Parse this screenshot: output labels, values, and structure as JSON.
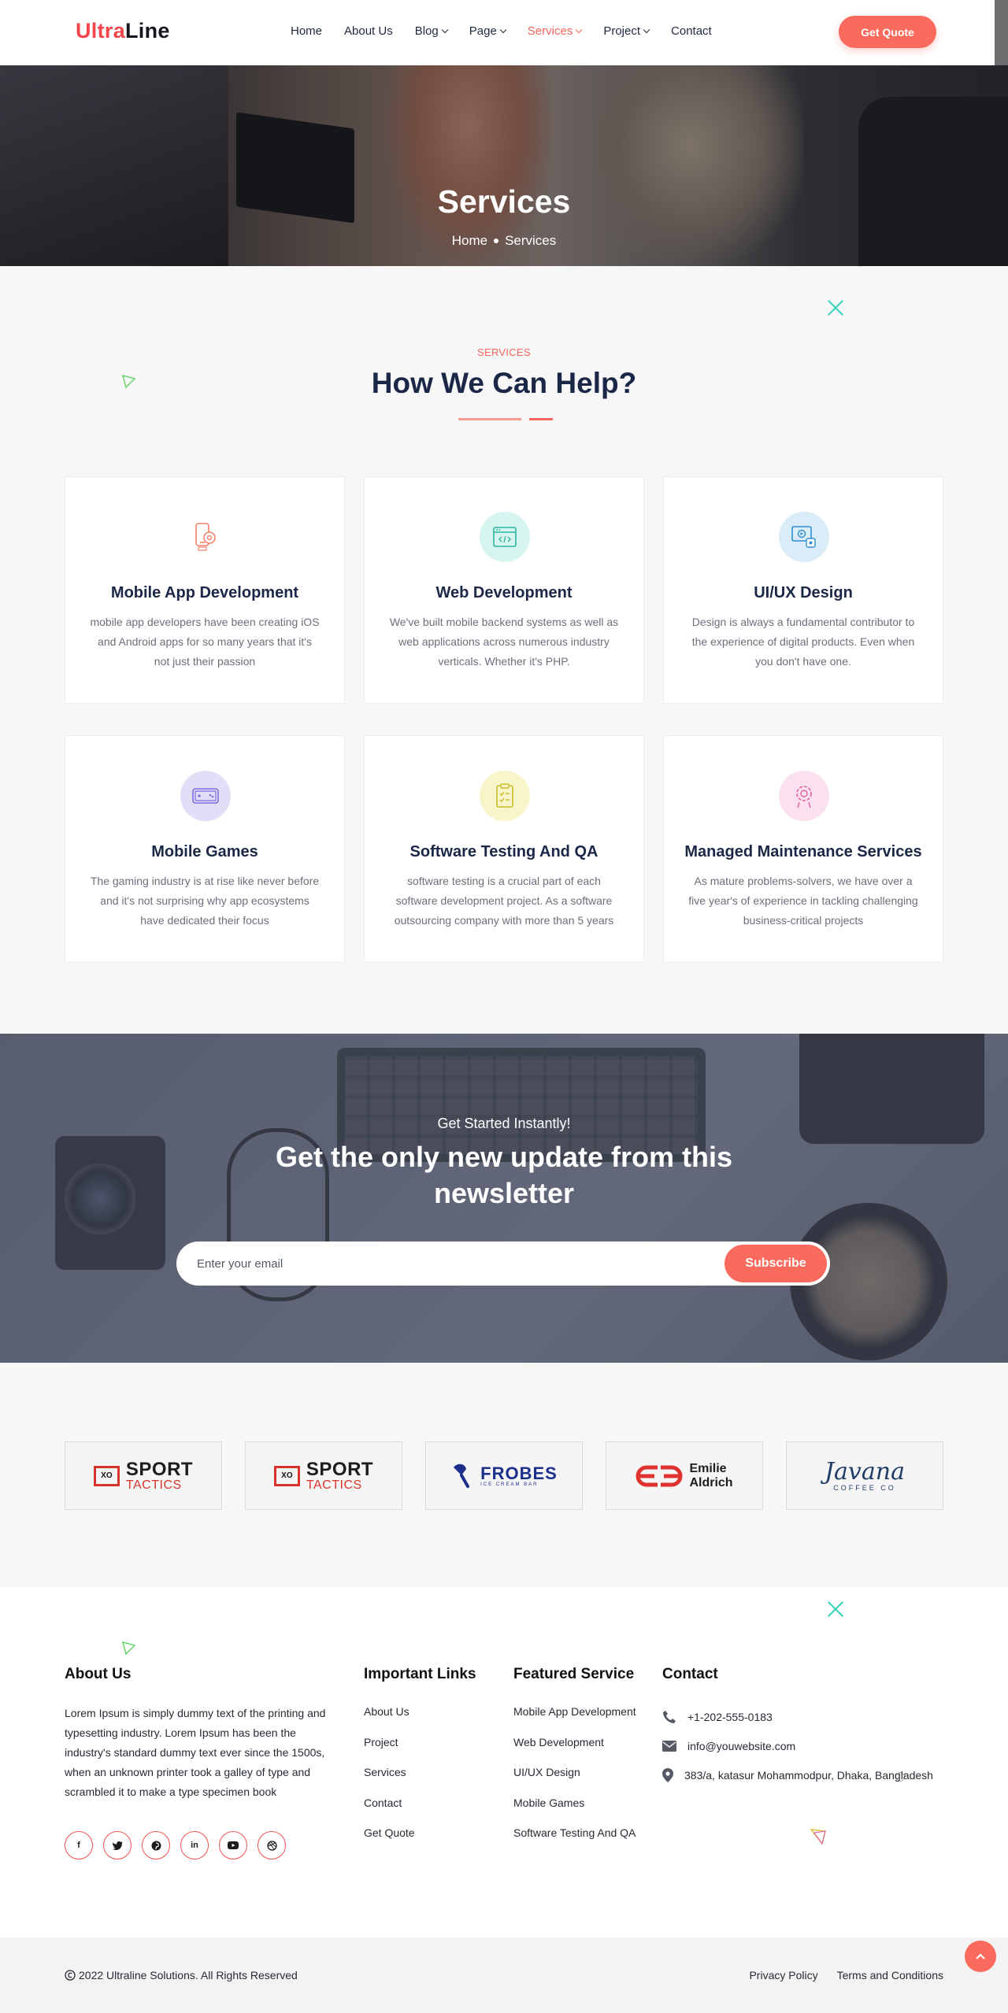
{
  "brand": {
    "part1": "Ultra",
    "part2": "Line"
  },
  "nav": {
    "items": [
      {
        "label": "Home"
      },
      {
        "label": "About Us"
      },
      {
        "label": "Blog"
      },
      {
        "label": "Page"
      },
      {
        "label": "Services"
      },
      {
        "label": "Project"
      },
      {
        "label": "Contact"
      }
    ],
    "active": "Services",
    "quote_label": "Get Quote"
  },
  "hero": {
    "title": "Services",
    "breadcrumb": [
      "Home",
      "Services"
    ]
  },
  "services": {
    "kicker": "SERVICES",
    "title": "How We Can Help?",
    "cards": [
      {
        "title": "Mobile App Development",
        "text": "mobile app developers have been creating iOS and Android apps for so many years that it's not just their passion",
        "icon": "mobile-gear-icon",
        "icon_bg": "#fdeae7",
        "icon_color": "#f4826b"
      },
      {
        "title": "Web Development",
        "text": "We've built mobile backend systems as well as web applications across numerous industry verticals. Whether it's PHP.",
        "icon": "browser-code-icon",
        "icon_bg": "#d6f5ee",
        "icon_color": "#2fb7a0"
      },
      {
        "title": "UI/UX Design",
        "text": "Design is always a fundamental contributor to the experience of digital products. Even when you don't have one.",
        "icon": "design-monitor-icon",
        "icon_bg": "#d9ecf8",
        "icon_color": "#2f8fcf"
      },
      {
        "title": "Mobile Games",
        "text": "The gaming industry is at rise like never before and it's not surprising why app ecosystems have dedicated their focus",
        "icon": "gamepad-icon",
        "icon_bg": "#e3def8",
        "icon_color": "#7d6be0"
      },
      {
        "title": "Software Testing And QA",
        "text": "software testing is a crucial part of each software development project. As a software outsourcing company with more than 5 years",
        "icon": "checklist-icon",
        "icon_bg": "#f7f5c9",
        "icon_color": "#c8bd25"
      },
      {
        "title": "Managed Maintenance Services",
        "text": "As mature problems-solvers, we have over a five year's of experience in tackling challenging business-critical projects",
        "icon": "maintenance-gear-icon",
        "icon_bg": "#fbe1ef",
        "icon_color": "#e0619f"
      }
    ]
  },
  "newsletter": {
    "kicker": "Get Started Instantly!",
    "title": "Get the only new update from this newsletter",
    "placeholder": "Enter your email",
    "button": "Subscribe"
  },
  "partners": [
    {
      "name": "SPORT",
      "sub": "TACTICS",
      "mark": "XO"
    },
    {
      "name": "SPORT",
      "sub": "TACTICS",
      "mark": "XO"
    },
    {
      "name": "FROBES",
      "sub": "ICE CREAM BAR"
    },
    {
      "name1": "Emilie",
      "name2": "Aldrich"
    },
    {
      "name": "Javana",
      "sub": "COFFEE CO"
    }
  ],
  "footer": {
    "about_heading": "About Us",
    "about_text": "Lorem Ipsum is simply dummy text of the printing and typesetting industry. Lorem Ipsum has been the industry's standard dummy text ever since the 1500s, when an unknown printer took a galley of type and scrambled it to make a type specimen book",
    "links_heading": "Important Links",
    "links": [
      "About Us",
      "Project",
      "Services",
      "Contact",
      "Get Quote"
    ],
    "featured_heading": "Featured Service",
    "featured": [
      "Mobile App Development",
      "Web Development",
      "UI/UX Design",
      "Mobile Games",
      "Software Testing And QA"
    ],
    "contact_heading": "Contact",
    "phone": "+1-202-555-0183",
    "email": "info@youwebsite.com",
    "address": "383/a, katasur Mohammodpur, Dhaka, Bangladesh",
    "social": [
      "facebook-icon",
      "twitter-icon",
      "pinterest-icon",
      "linkedin-icon",
      "youtube-icon",
      "dribbble-icon"
    ]
  },
  "bottom": {
    "copyright": "2022 Ultraline Solutions. All Rights Reserved",
    "privacy": "Privacy Policy",
    "terms": "Terms and Conditions"
  },
  "colors": {
    "accent": "#fa6b5e",
    "navy": "#1b2747",
    "teal": "#2fd2b8"
  }
}
